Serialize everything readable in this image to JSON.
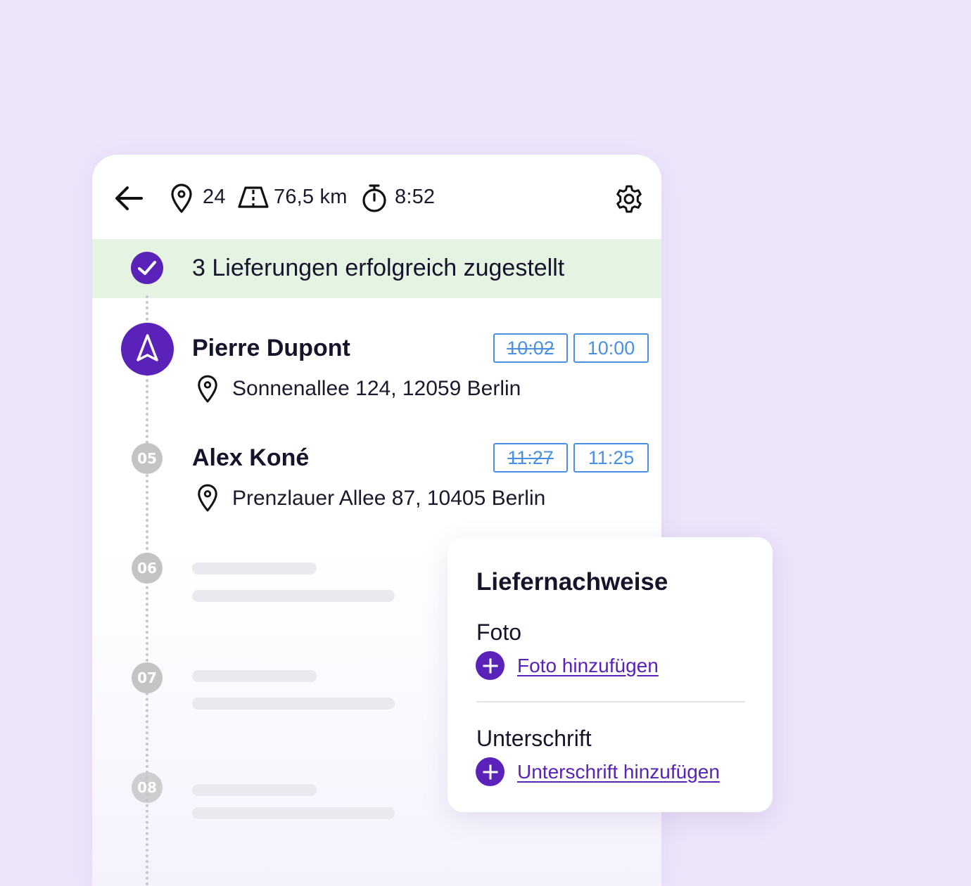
{
  "header": {
    "stops": "24",
    "distance": "76,5 km",
    "duration": "8:52",
    "icons": [
      "back-arrow-icon",
      "map-pin-icon",
      "road-icon",
      "stopwatch-icon",
      "gear-icon"
    ]
  },
  "banner": {
    "text": "3 Lieferungen erfolgreich zugestellt"
  },
  "stops": [
    {
      "name": "Pierre Dupont",
      "address": "Sonnenallee 124, 12059 Berlin",
      "time_old": "10:02",
      "time_new": "10:00"
    },
    {
      "number": "05",
      "name": "Alex Koné",
      "address": "Prenzlauer Allee 87, 10405 Berlin",
      "time_old": "11:27",
      "time_new": "11:25"
    }
  ],
  "placeholder_stops": [
    "06",
    "07",
    "08"
  ],
  "proof_panel": {
    "title": "Liefernachweise",
    "photo_label": "Foto",
    "photo_link": "Foto hinzufügen",
    "signature_label": "Unterschrift",
    "signature_link": "Unterschrift hinzufügen"
  },
  "colors": {
    "background": "#ede5fa",
    "accent_purple": "#5a22b8",
    "success_banner": "#e5f3e3",
    "time_blue": "#4a90e2",
    "skeleton": "#ebe8f0"
  }
}
